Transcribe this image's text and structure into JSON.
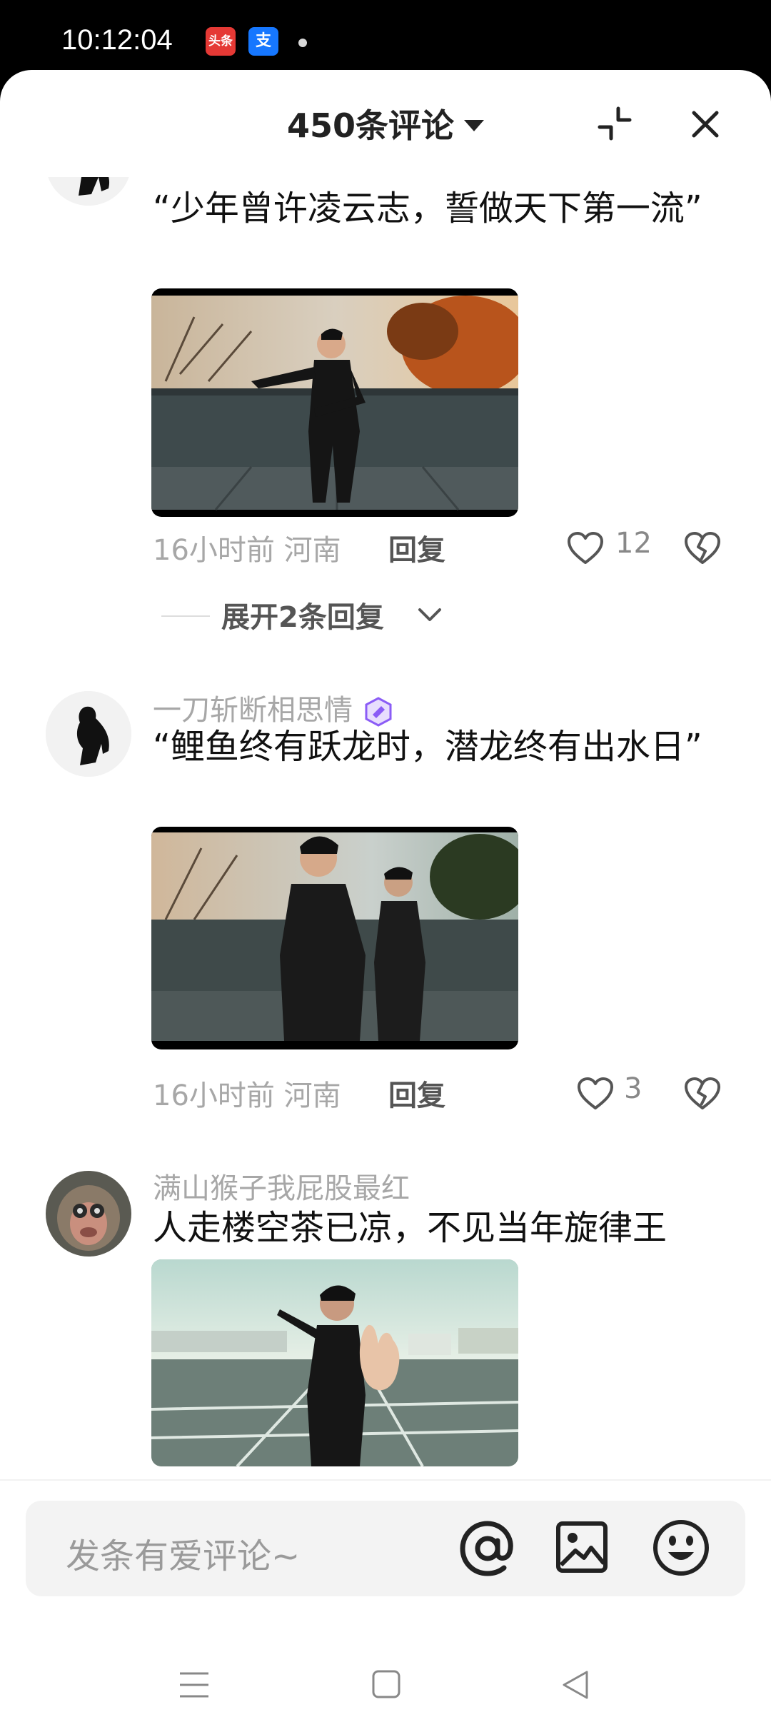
{
  "status_bar": {
    "time": "10:12:04",
    "app_icons": [
      {
        "name": "toutiao-icon",
        "label": "头条",
        "color": "#e53935"
      },
      {
        "name": "alipay-icon",
        "label": "支",
        "color": "#1677ff"
      }
    ]
  },
  "header": {
    "title": "450条评论",
    "collapse_icon": "collapse-icon",
    "close_icon": "close-icon"
  },
  "comments": [
    {
      "username": "",
      "text": "“少年曾许凌云志，誓做天下第一流”",
      "time": "16小时前",
      "location": "河南",
      "reply_label": "回复",
      "likes": "12",
      "expand_label": "展开2条回复"
    },
    {
      "username": "一刀斩断相思情",
      "badge_icon": "purple-badge-icon",
      "text": "“鲤鱼终有跃龙时，潜龙终有出水日”",
      "time": "16小时前",
      "location": "河南",
      "reply_label": "回复",
      "likes": "3"
    },
    {
      "username": "满山猴子我屁股最红",
      "text": "人走楼空茶已凉，不见当年旋律王"
    }
  ],
  "input": {
    "placeholder": "发条有爱评论~",
    "icons": [
      "at-icon",
      "image-icon",
      "emoji-icon"
    ]
  },
  "colors": {
    "meta_gray": "#a7a7a7",
    "badge_purple": "#8b5cf6",
    "input_bg": "#f3f3f3"
  }
}
